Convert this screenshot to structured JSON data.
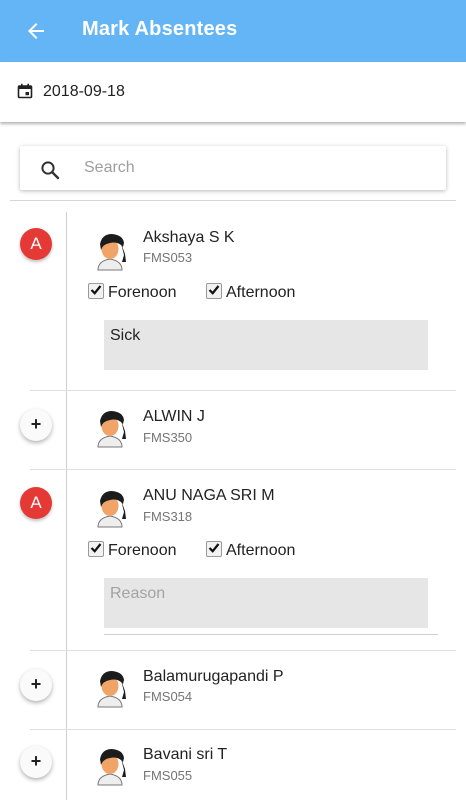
{
  "header": {
    "title": "Mark Absentees"
  },
  "date": {
    "value": "2018-09-18"
  },
  "search": {
    "placeholder": "Search"
  },
  "students": [
    {
      "name": "Akshaya S K",
      "code": "FMS053",
      "absent": true,
      "status_label": "A",
      "forenoon": true,
      "afternoon": true,
      "forenoon_label": "Forenoon",
      "afternoon_label": "Afternoon",
      "reason": "Sick",
      "reason_placeholder": "Reason"
    },
    {
      "name": "ALWIN J",
      "code": "FMS350",
      "absent": false,
      "add_label": "+"
    },
    {
      "name": "ANU NAGA SRI M",
      "code": "FMS318",
      "absent": true,
      "status_label": "A",
      "forenoon": true,
      "afternoon": true,
      "forenoon_label": "Forenoon",
      "afternoon_label": "Afternoon",
      "reason": "",
      "reason_placeholder": "Reason"
    },
    {
      "name": "Balamurugapandi P",
      "code": "FMS054",
      "absent": false,
      "add_label": "+"
    },
    {
      "name": "Bavani sri T",
      "code": "FMS055",
      "absent": false,
      "add_label": "+"
    }
  ],
  "colors": {
    "appbar": "#64b5f6",
    "absent_badge": "#e53935"
  },
  "icons": {
    "back": "arrow-back-icon",
    "calendar": "calendar-icon",
    "search": "search-icon",
    "avatar": "student-avatar-icon"
  }
}
